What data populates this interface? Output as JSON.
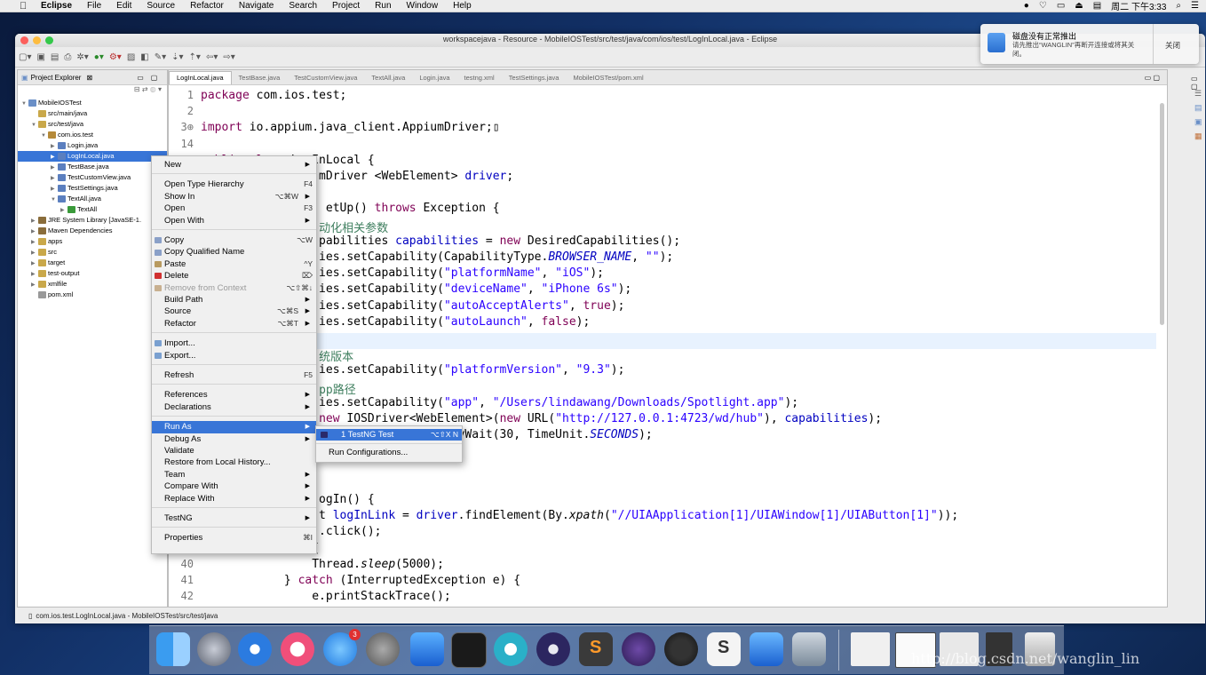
{
  "menubar": {
    "app": "Eclipse",
    "items": [
      "File",
      "Edit",
      "Source",
      "Refactor",
      "Navigate",
      "Search",
      "Project",
      "Run",
      "Window",
      "Help"
    ],
    "clock": "周二 下午3:33"
  },
  "window": {
    "title": "workspacejava - Resource - MobileIOSTest/src/test/java/com/ios/test/LogInLocal.java - Eclipse"
  },
  "notification": {
    "title": "磁盘没有正常推出",
    "body": "请先推出“WANGLIN”再断开连接或将其关闭。",
    "close_label": "关闭"
  },
  "project_explorer": {
    "tab_label": "Project Explorer",
    "tree": [
      {
        "label": "MobileIOSTest",
        "indent": 0,
        "tri": "▼",
        "kind": "project"
      },
      {
        "label": "src/main/java",
        "indent": 1,
        "tri": "",
        "kind": "folder"
      },
      {
        "label": "src/test/java",
        "indent": 1,
        "tri": "▼",
        "kind": "folder"
      },
      {
        "label": "com.ios.test",
        "indent": 2,
        "tri": "▼",
        "kind": "package"
      },
      {
        "label": "Login.java",
        "indent": 3,
        "tri": "▶",
        "kind": "java"
      },
      {
        "label": "LogInLocal.java",
        "indent": 3,
        "tri": "▶",
        "kind": "java",
        "selected": true
      },
      {
        "label": "TestBase.java",
        "indent": 3,
        "tri": "▶",
        "kind": "java"
      },
      {
        "label": "TestCustomView.java",
        "indent": 3,
        "tri": "▶",
        "kind": "java"
      },
      {
        "label": "TestSettings.java",
        "indent": 3,
        "tri": "▶",
        "kind": "java"
      },
      {
        "label": "TextAll.java",
        "indent": 3,
        "tri": "▼",
        "kind": "java"
      },
      {
        "label": "TextAll",
        "indent": 4,
        "tri": "▶",
        "kind": "class"
      },
      {
        "label": "JRE System Library [JavaSE-1.",
        "indent": 1,
        "tri": "▶",
        "kind": "lib"
      },
      {
        "label": "Maven Dependencies",
        "indent": 1,
        "tri": "▶",
        "kind": "lib"
      },
      {
        "label": "apps",
        "indent": 1,
        "tri": "▶",
        "kind": "folder"
      },
      {
        "label": "src",
        "indent": 1,
        "tri": "▶",
        "kind": "folder"
      },
      {
        "label": "target",
        "indent": 1,
        "tri": "▶",
        "kind": "folder"
      },
      {
        "label": "test-output",
        "indent": 1,
        "tri": "▶",
        "kind": "folder"
      },
      {
        "label": "xmlfile",
        "indent": 1,
        "tri": "▶",
        "kind": "folder"
      },
      {
        "label": "pom.xml",
        "indent": 1,
        "tri": "",
        "kind": "file"
      }
    ]
  },
  "editor": {
    "tabs": [
      "LogInLocal.java",
      "TestBase.java",
      "TestCustomView.java",
      "TextAll.java",
      "Login.java",
      "testng.xml",
      "TestSettings.java",
      "MobileIOSTest/pom.xml"
    ],
    "lines": [
      {
        "n": "1",
        "html": "<span class='kw'>package</span> com.ios.test;"
      },
      {
        "n": "2",
        "html": ""
      },
      {
        "n": "3⊕",
        "html": "<span class='kw'>import</span> io.appium.java_client.AppiumDriver;▯"
      },
      {
        "n": "14",
        "html": ""
      },
      {
        "n": "",
        "html": "<span class='kw'>public class</span> LogInLocal {"
      },
      {
        "n": "",
        "html": "                 mDriver &lt;WebElement&gt; <span class='fld'>driver</span>;"
      },
      {
        "n": "",
        "html": ""
      },
      {
        "n": "",
        "html": "                  etUp() <span class='kw'>throws</span> Exception {"
      },
      {
        "n": "",
        "html": "                 <span class='cmt'>动化相关参数</span>"
      },
      {
        "n": "",
        "html": "                 pabilities <span class='fld'>capabilities</span> = <span class='kw'>new</span> DesiredCapabilities();"
      },
      {
        "n": "",
        "html": "                 ies.setCapability(CapabilityType.<span class='ital'>BROWSER_NAME</span>, <span class='str'>\"\"</span>);"
      },
      {
        "n": "",
        "html": "                 ies.setCapability(<span class='str'>\"platformName\"</span>, <span class='str'>\"iOS\"</span>);"
      },
      {
        "n": "",
        "html": "                 ies.setCapability(<span class='str'>\"deviceName\"</span>, <span class='str'>\"iPhone 6s\"</span>);"
      },
      {
        "n": "",
        "html": "                 ies.setCapability(<span class='str'>\"autoAcceptAlerts\"</span>, <span class='kw'>true</span>);"
      },
      {
        "n": "",
        "html": "                 ies.setCapability(<span class='str'>\"autoLaunch\"</span>, <span class='kw'>false</span>);"
      },
      {
        "n": "",
        "html": ""
      },
      {
        "n": "",
        "html": "                 <span class='cmt'>统版本</span>"
      },
      {
        "n": "",
        "html": "                 ies.setCapability(<span class='str'>\"platformVersion\"</span>, <span class='str'>\"9.3\"</span>);"
      },
      {
        "n": "",
        "html": "                 <span class='cmt'>pp路径</span>"
      },
      {
        "n": "",
        "html": "                 ies.setCapability(<span class='str'>\"app\"</span>, <span class='str'>\"/Users/lindawang/Downloads/Spotlight.app\"</span>);"
      },
      {
        "n": "",
        "html": "                 <span class='kw'>new</span> IOSDriver&lt;WebElement&gt;(<span class='kw'>new</span> URL(<span class='str'>\"http://127.0.0.1:4723/wd/hub\"</span>), <span class='fld'>capabilities</span>);"
      },
      {
        "n": "",
        "html": "                               licitlyWait(30, TimeUnit.<span class='ital'>SECONDS</span>);"
      },
      {
        "n": "",
        "html": ""
      },
      {
        "n": "",
        "html": ""
      },
      {
        "n": "",
        "html": ""
      },
      {
        "n": "",
        "html": "                 ogIn() {"
      },
      {
        "n": "",
        "html": "                 t <span class='fld'>logInLink</span> = <span class='fld'>driver</span>.findElement(By.<span class='ital' style='color:#000'>xpath</span>(<span class='str'>\"//UIAApplication[1]/UIAWindow[1]/UIAButton[1]\"</span>));"
      },
      {
        "n": "",
        "html": "                 .click();"
      },
      {
        "n": "",
        "html": "            <span class='kw'>try</span> {"
      },
      {
        "n": "40",
        "html": "                Thread.<span style='font-style:italic'>sleep</span>(5000);"
      },
      {
        "n": "41",
        "html": "            } <span class='kw'>catch</span> (InterruptedException e) {"
      },
      {
        "n": "42",
        "html": "                e.printStackTrace();"
      }
    ]
  },
  "context_menu": [
    {
      "label": "New",
      "submenu": true
    },
    {
      "sep": true
    },
    {
      "label": "Open Type Hierarchy",
      "shortcut": "F4"
    },
    {
      "label": "Show In",
      "shortcut": "⌥⌘W",
      "submenu": true
    },
    {
      "label": "Open",
      "shortcut": "F3"
    },
    {
      "label": "Open With",
      "submenu": true
    },
    {
      "sep": true
    },
    {
      "label": "Copy",
      "shortcut": "⌥W",
      "icon": "copy"
    },
    {
      "label": "Copy Qualified Name",
      "icon": "copy"
    },
    {
      "label": "Paste",
      "shortcut": "^Y",
      "icon": "paste"
    },
    {
      "label": "Delete",
      "shortcut": "⌦",
      "icon": "delete"
    },
    {
      "label": "Remove from Context",
      "shortcut": "⌥⇧⌘↓",
      "disabled": true,
      "icon": "remove"
    },
    {
      "label": "Build Path",
      "submenu": true
    },
    {
      "label": "Source",
      "shortcut": "⌥⌘S",
      "submenu": true
    },
    {
      "label": "Refactor",
      "shortcut": "⌥⌘T",
      "submenu": true
    },
    {
      "sep": true
    },
    {
      "label": "Import...",
      "icon": "import"
    },
    {
      "label": "Export...",
      "icon": "export"
    },
    {
      "sep": true
    },
    {
      "label": "Refresh",
      "shortcut": "F5"
    },
    {
      "sep": true
    },
    {
      "label": "References",
      "submenu": true
    },
    {
      "label": "Declarations",
      "submenu": true
    },
    {
      "sep": true
    },
    {
      "label": "Run As",
      "submenu": true,
      "highlight": true
    },
    {
      "label": "Debug As",
      "submenu": true
    },
    {
      "label": "Validate"
    },
    {
      "label": "Restore from Local History..."
    },
    {
      "label": "Team",
      "submenu": true
    },
    {
      "label": "Compare With",
      "submenu": true
    },
    {
      "label": "Replace With",
      "submenu": true
    },
    {
      "sep": true
    },
    {
      "label": "TestNG",
      "submenu": true
    },
    {
      "sep": true
    },
    {
      "label": "Properties",
      "shortcut": "⌘I"
    }
  ],
  "submenu": [
    {
      "label": "1 TestNG Test",
      "shortcut": "⌥⇧X N",
      "highlight": true
    },
    {
      "sep": true
    },
    {
      "label": "Run Configurations..."
    }
  ],
  "status_bar": "com.ios.test.LogInLocal.java - MobileIOSTest/src/test/java",
  "dock_badge": "3",
  "watermark": "http://blog.csdn.net/wanglin_lin"
}
